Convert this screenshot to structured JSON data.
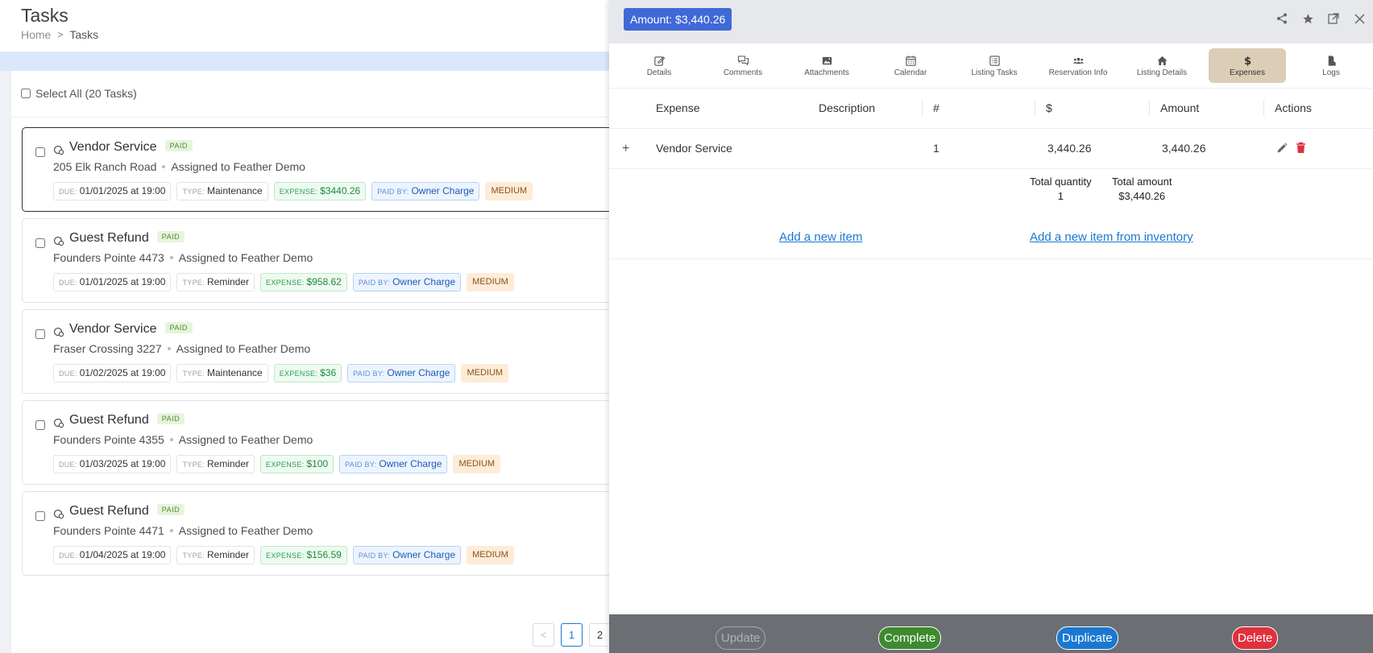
{
  "header": {
    "title": "Tasks",
    "breadcrumb": [
      "Home",
      "Tasks"
    ],
    "breadcrumb_sep": ">"
  },
  "list": {
    "select_all_label": "Select All (20 Tasks)",
    "tasks": [
      {
        "title": "Vendor Service",
        "status": "PAID",
        "location": "205 Elk Ranch Road",
        "assigned": "Assigned to Feather Demo",
        "due_key": "DUE:",
        "due": "01/01/2025 at 19:00",
        "type_key": "TYPE:",
        "type": "Maintenance",
        "expense_key": "EXPENSE:",
        "expense": "$3440.26",
        "paidby_key": "PAID BY:",
        "paidby": "Owner Charge",
        "priority": "MEDIUM"
      },
      {
        "title": "Guest Refund",
        "status": "PAID",
        "location": "Founders Pointe 4473",
        "assigned": "Assigned to Feather Demo",
        "due_key": "DUE:",
        "due": "01/01/2025 at 19:00",
        "type_key": "TYPE:",
        "type": "Reminder",
        "expense_key": "EXPENSE:",
        "expense": "$958.62",
        "paidby_key": "PAID BY:",
        "paidby": "Owner Charge",
        "priority": "MEDIUM"
      },
      {
        "title": "Vendor Service",
        "status": "PAID",
        "location": "Fraser Crossing 3227",
        "assigned": "Assigned to Feather Demo",
        "due_key": "DUE:",
        "due": "01/02/2025 at 19:00",
        "type_key": "TYPE:",
        "type": "Maintenance",
        "expense_key": "EXPENSE:",
        "expense": "$36",
        "paidby_key": "PAID BY:",
        "paidby": "Owner Charge",
        "priority": "MEDIUM"
      },
      {
        "title": "Guest Refund",
        "status": "PAID",
        "location": "Founders Pointe 4355",
        "assigned": "Assigned to Feather Demo",
        "due_key": "DUE:",
        "due": "01/03/2025 at 19:00",
        "type_key": "TYPE:",
        "type": "Reminder",
        "expense_key": "EXPENSE:",
        "expense": "$100",
        "paidby_key": "PAID BY:",
        "paidby": "Owner Charge",
        "priority": "MEDIUM"
      },
      {
        "title": "Guest Refund",
        "status": "PAID",
        "location": "Founders Pointe 4471",
        "assigned": "Assigned to Feather Demo",
        "due_key": "DUE:",
        "due": "01/04/2025 at 19:00",
        "type_key": "TYPE:",
        "type": "Reminder",
        "expense_key": "EXPENSE:",
        "expense": "$156.59",
        "paidby_key": "PAID BY:",
        "paidby": "Owner Charge",
        "priority": "MEDIUM"
      }
    ],
    "pagination": {
      "prev": "<",
      "pages": [
        "1",
        "2"
      ],
      "current": "1"
    }
  },
  "drawer": {
    "amount_badge": "Amount: $3,440.26",
    "header_icons": [
      "share-icon",
      "star-icon",
      "external-link-icon",
      "close-icon"
    ],
    "tabs": [
      {
        "label": "Details",
        "icon": "edit-icon"
      },
      {
        "label": "Comments",
        "icon": "comments-icon"
      },
      {
        "label": "Attachments",
        "icon": "image-icon"
      },
      {
        "label": "Calendar",
        "icon": "calendar-icon"
      },
      {
        "label": "Listing Tasks",
        "icon": "list-icon"
      },
      {
        "label": "Reservation Info",
        "icon": "users-icon"
      },
      {
        "label": "Listing Details",
        "icon": "home-icon"
      },
      {
        "label": "Expenses",
        "icon": "dollar-icon"
      },
      {
        "label": "Logs",
        "icon": "log-icon"
      }
    ],
    "active_tab": "Expenses",
    "table": {
      "headers": [
        "Expense",
        "Description",
        "#",
        "$",
        "Amount",
        "Actions"
      ],
      "rows": [
        {
          "expand": "+",
          "expense": "Vendor Service",
          "description": "",
          "qty": "1",
          "price": "3,440.26",
          "amount": "3,440.26"
        }
      ]
    },
    "totals": {
      "quantity_label": "Total quantity",
      "quantity": "1",
      "amount_label": "Total amount",
      "amount": "$3,440.26"
    },
    "links": {
      "add_item": "Add a new item",
      "add_inventory": "Add a new item from inventory"
    },
    "footer": {
      "update": "Update",
      "complete": "Complete",
      "duplicate": "Duplicate",
      "delete": "Delete"
    }
  },
  "colors": {
    "accent": "#1b78d0",
    "amount_badge": "#4069d8",
    "active_tab": "#dccdb6",
    "complete": "#3e8a2e",
    "delete": "#e0303d",
    "footer_bg": "#6b6f73"
  }
}
